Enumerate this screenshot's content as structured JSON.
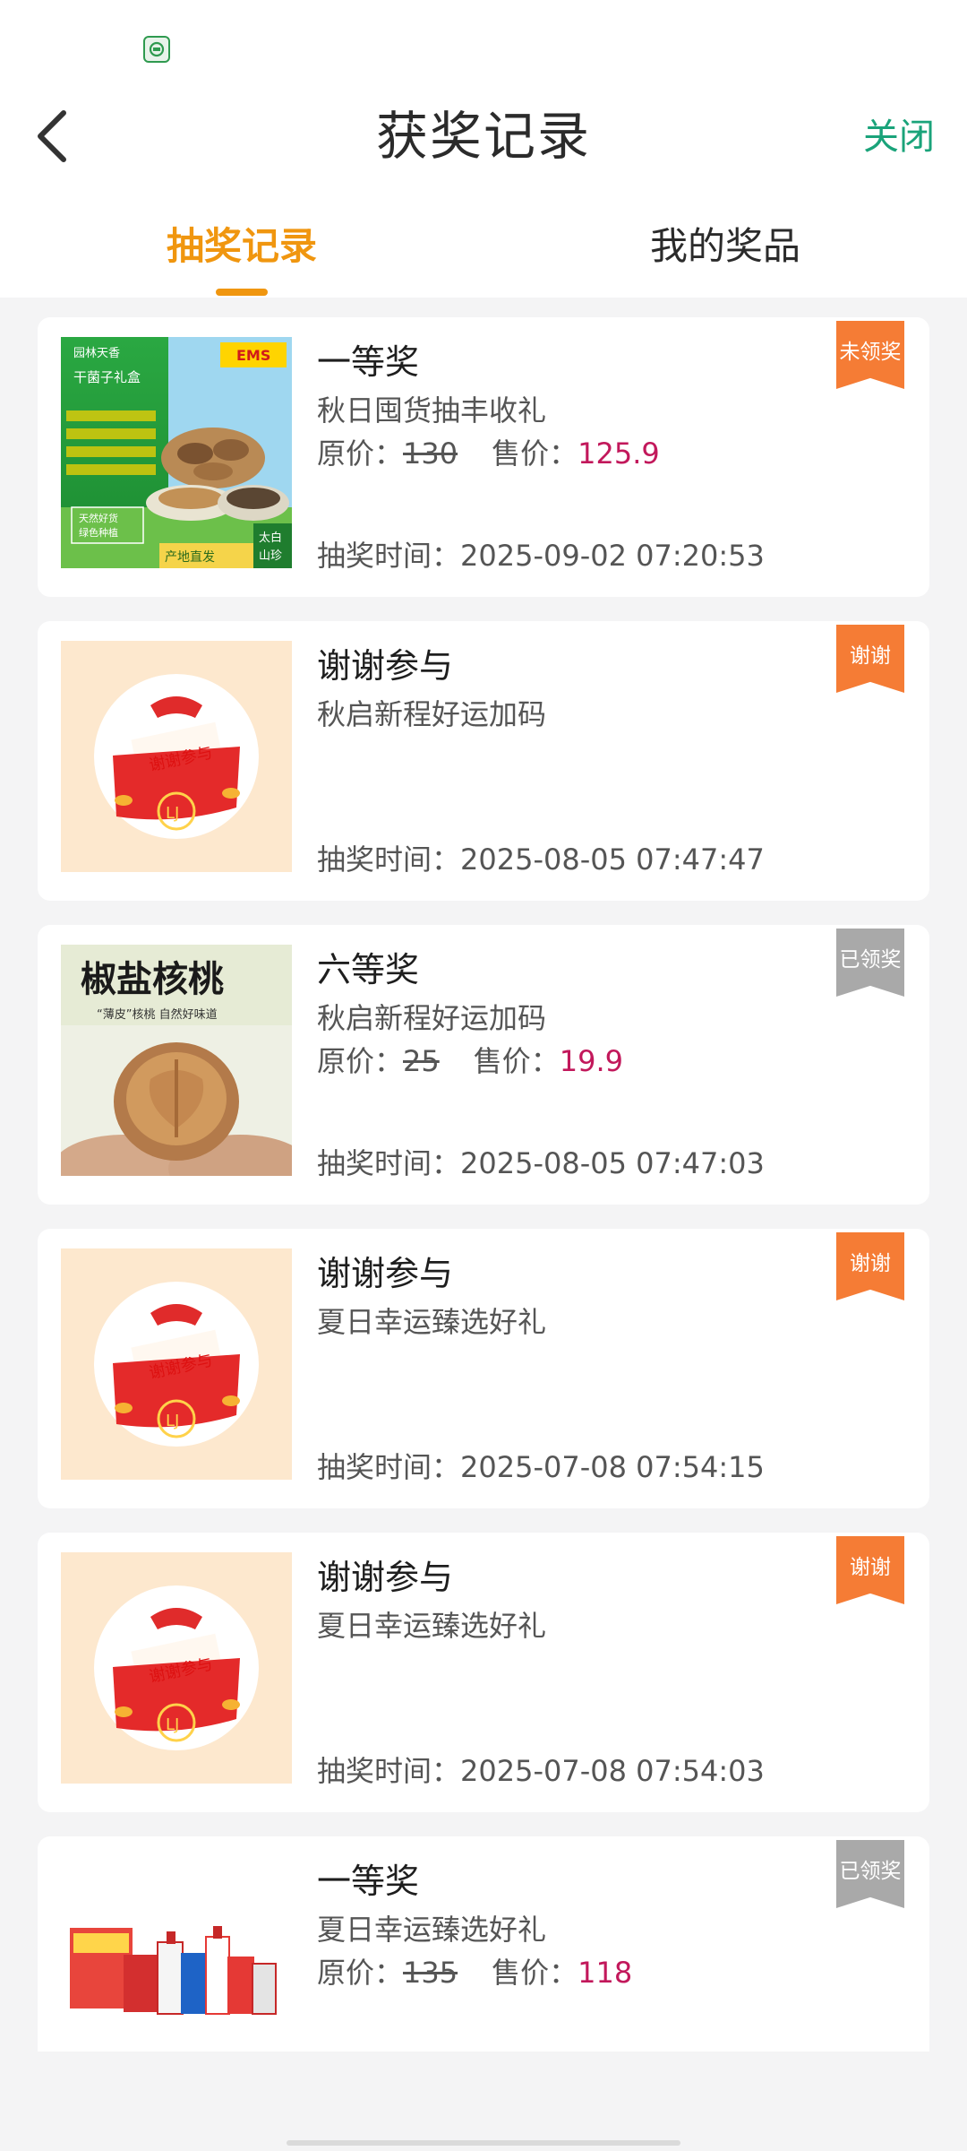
{
  "header": {
    "title": "获奖记录",
    "close_label": "关闭"
  },
  "tabs": [
    {
      "label": "抽奖记录",
      "active": true
    },
    {
      "label": "我的奖品",
      "active": false
    }
  ],
  "labels": {
    "orig_price": "原价：",
    "sale_price": "售价：",
    "draw_time": "抽奖时间："
  },
  "records": [
    {
      "name": "一等奖",
      "activity": "秋日囤货抽丰收礼",
      "orig_price": "130",
      "sale_price": "125.9",
      "time": "2025-09-02 07:20:53",
      "badge": "未领奖",
      "badge_color": "#f57c35",
      "image": "mushroom-gift-box",
      "image_text": {
        "brand": "园林天香",
        "box": "干菌子礼盒",
        "ems": "EMS",
        "s1": "天然好货",
        "s2": "绿色种植",
        "tag": "产地直发",
        "place1": "太白",
        "place2": "山珍"
      }
    },
    {
      "name": "谢谢参与",
      "activity": "秋启新程好运加码",
      "time": "2025-08-05 07:47:47",
      "badge": "谢谢",
      "badge_color": "#f57c35",
      "image": "thanks-envelope",
      "image_text": {
        "envelope": "谢谢参与",
        "logo": "LJ"
      }
    },
    {
      "name": "六等奖",
      "activity": "秋启新程好运加码",
      "orig_price": "25",
      "sale_price": "19.9",
      "time": "2025-08-05 07:47:03",
      "badge": "已领奖",
      "badge_color": "#a9a9a9",
      "image": "walnut",
      "image_text": {
        "big": "椒盐核桃",
        "sub": "“薄皮”核桃 自然好味道"
      }
    },
    {
      "name": "谢谢参与",
      "activity": "夏日幸运臻选好礼",
      "time": "2025-07-08 07:54:15",
      "badge": "谢谢",
      "badge_color": "#f57c35",
      "image": "thanks-envelope",
      "image_text": {
        "envelope": "谢谢参与",
        "logo": "LJ"
      }
    },
    {
      "name": "谢谢参与",
      "activity": "夏日幸运臻选好礼",
      "time": "2025-07-08 07:54:03",
      "badge": "谢谢",
      "badge_color": "#f57c35",
      "image": "thanks-envelope",
      "image_text": {
        "envelope": "谢谢参与",
        "logo": "LJ"
      }
    },
    {
      "name": "一等奖",
      "activity": "夏日幸运臻选好礼",
      "orig_price": "135",
      "sale_price": "118",
      "badge": "已领奖",
      "badge_color": "#a9a9a9",
      "image": "cleaning-gift-set"
    }
  ]
}
